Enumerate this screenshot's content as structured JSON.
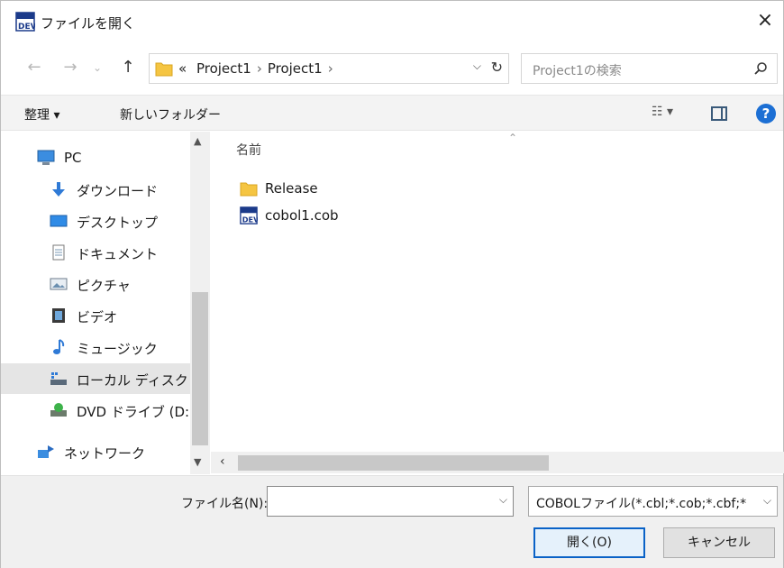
{
  "window": {
    "title": "ファイルを開く",
    "close_glyph": "×"
  },
  "nav": {
    "back_glyph": "←",
    "forward_glyph": "→",
    "recent_glyph": "⌄",
    "up_glyph": "↑",
    "breadcrumb_prefix": "«",
    "breadcrumb": [
      "Project1",
      "Project1"
    ],
    "breadcrumb_trail": "›",
    "search_placeholder": "Project1の検索"
  },
  "toolbar": {
    "organize_label": "整理 ▾",
    "new_folder_label": "新しいフォルダー",
    "view_label": "☷ ▾",
    "help_glyph": "?"
  },
  "sidebar": {
    "items": [
      {
        "label": "PC",
        "icon": "pc-icon"
      },
      {
        "label": "ダウンロード",
        "icon": "download-icon"
      },
      {
        "label": "デスクトップ",
        "icon": "desktop-icon"
      },
      {
        "label": "ドキュメント",
        "icon": "document-icon"
      },
      {
        "label": "ピクチャ",
        "icon": "picture-icon"
      },
      {
        "label": "ビデオ",
        "icon": "video-icon"
      },
      {
        "label": "ミュージック",
        "icon": "music-icon"
      },
      {
        "label": "ローカル ディスク (C",
        "icon": "disk-icon",
        "selected": true
      },
      {
        "label": "DVD ドライブ (D:)",
        "icon": "dvd-icon"
      },
      {
        "label": "ネットワーク",
        "icon": "network-icon"
      }
    ]
  },
  "file_list": {
    "column_name": "名前",
    "items": [
      {
        "name": "Release",
        "type": "folder"
      },
      {
        "name": "cobol1.cob",
        "type": "cobol-file"
      }
    ]
  },
  "bottom": {
    "filename_label": "ファイル名(N):",
    "filename_value": "",
    "filter_value": "COBOLファイル(*.cbl;*.cob;*.cbf;*",
    "open_label": "開く(O)",
    "cancel_label": "キャンセル"
  },
  "colors": {
    "accent": "#0a62c7",
    "folder": "#f5c542",
    "help": "#1c6fd4"
  }
}
